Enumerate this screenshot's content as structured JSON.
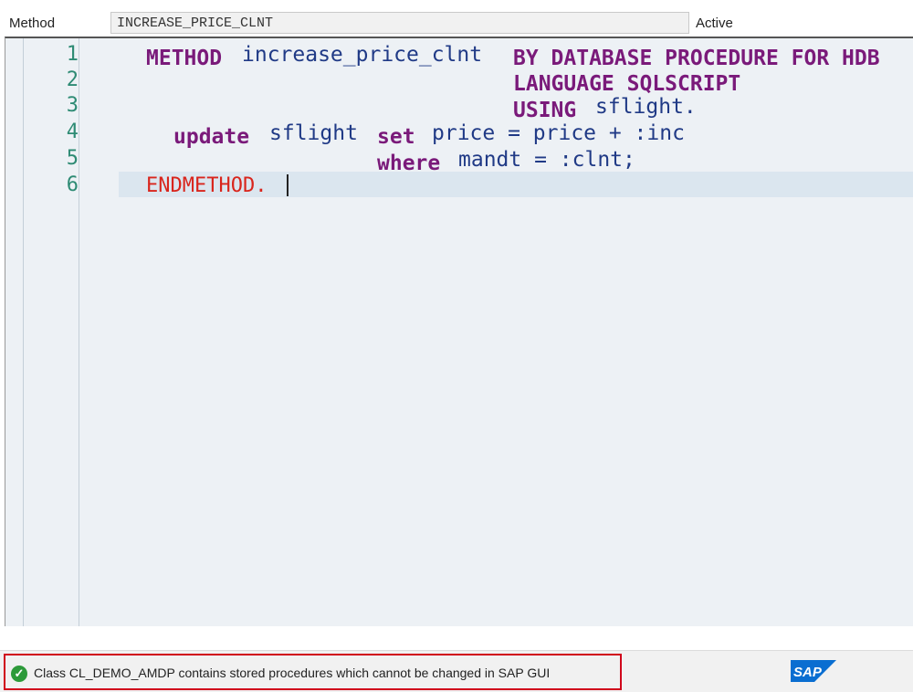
{
  "header": {
    "label": "Method",
    "method_name": "INCREASE_PRICE_CLNT",
    "status": "Active"
  },
  "editor": {
    "line_numbers": [
      "1",
      "2",
      "3",
      "4",
      "5",
      "6"
    ],
    "code": {
      "l1_kw_method": "METHOD",
      "l1_name": "increase_price_clnt",
      "l1_kw_by": "BY DATABASE PROCEDURE FOR HDB",
      "l2_kw_lang": "LANGUAGE SQLSCRIPT",
      "l3_kw_using": "USING",
      "l3_table": "sflight.",
      "l4_kw_update": "update",
      "l4_table": "sflight",
      "l4_kw_set": "set",
      "l4_expr": "price = price + :inc",
      "l5_kw_where": "where",
      "l5_expr": "mandt = :clnt;",
      "l6_end": "ENDMETHOD."
    }
  },
  "statusbar": {
    "message": "Class CL_DEMO_AMDP contains stored procedures which cannot be changed in SAP GUI",
    "logo_text": "SAP"
  },
  "colors": {
    "keyword": "#7a1a7a",
    "identifier": "#203a86",
    "endmethod": "#d9251c",
    "line_number": "#2e8b74",
    "sap_blue": "#0a6ed1",
    "highlight_border": "#d0021b"
  }
}
